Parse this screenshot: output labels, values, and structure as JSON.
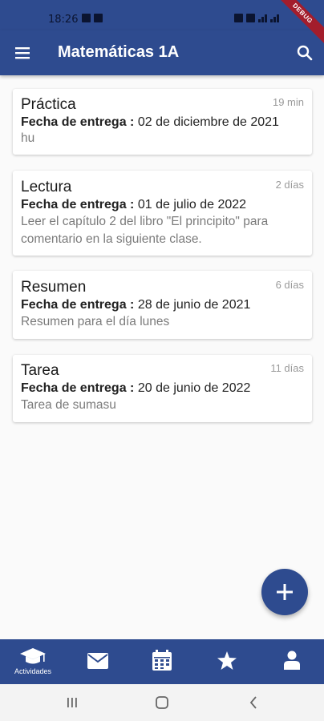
{
  "status_bar": {
    "time": "18:26"
  },
  "app_bar": {
    "title": "Matemáticas 1A",
    "debug_banner": "DEBUG"
  },
  "activities": [
    {
      "title": "Práctica",
      "time_ago": "19 min",
      "due_label": "Fecha de entrega :",
      "due_date": "02 de diciembre de 2021",
      "description": "hu"
    },
    {
      "title": "Lectura",
      "time_ago": "2 días",
      "due_label": "Fecha de entrega :",
      "due_date": "01 de julio de 2022",
      "description": "Leer el capítulo 2 del libro \"El principito\" para comentario en la siguiente clase."
    },
    {
      "title": "Resumen",
      "time_ago": "6 días",
      "due_label": "Fecha de entrega :",
      "due_date": "28 de junio de 2021",
      "description": "Resumen para el día lunes"
    },
    {
      "title": "Tarea",
      "time_ago": "11 días",
      "due_label": "Fecha de entrega :",
      "due_date": "20 de junio de 2022",
      "description": "Tarea de sumasu"
    }
  ],
  "bottom_nav": {
    "items": [
      {
        "icon": "graduation-cap-icon",
        "label": "Actividades"
      },
      {
        "icon": "envelope-icon",
        "label": ""
      },
      {
        "icon": "calendar-icon",
        "label": ""
      },
      {
        "icon": "star-icon",
        "label": ""
      },
      {
        "icon": "person-icon",
        "label": ""
      }
    ]
  },
  "colors": {
    "primary": "#2e4b8f",
    "debug_ribbon": "#a31d2c",
    "muted_text": "#7b7b7b"
  }
}
